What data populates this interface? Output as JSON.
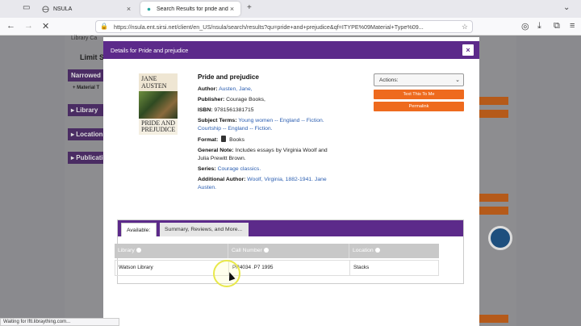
{
  "browser": {
    "tabs": [
      {
        "title": "NSULA",
        "active": false
      },
      {
        "title": "Search Results for pride and prejudice",
        "active": true
      }
    ],
    "url": "https://nsula.ent.sirsi.net/client/en_US/nsula/search/results?qu=pride+and+prejudice&qf=ITYPE%09Material+Type%09..."
  },
  "background": {
    "limit": "Limit S",
    "narrowed": "Narrowed",
    "material": "+ Material T",
    "library": "▸ Library",
    "location": "▸ Location",
    "publication": "▸ Publicatio",
    "library_catalog": "Library Ca"
  },
  "modal": {
    "header": "Details for Pride and prejudice",
    "close": "×",
    "cover": {
      "top_text": "JANE AUSTEN",
      "bottom_text": "PRIDE AND PREJUDICE"
    },
    "title": "Pride and prejudice",
    "author_label": "Author:",
    "author": "Austen, Jane,",
    "publisher_label": "Publisher:",
    "publisher": "Courage Books,",
    "isbn_label": "ISBN:",
    "isbn": "9781561381715",
    "subject_label": "Subject Terms:",
    "subject_1": "Young women -- England -- Fiction.",
    "subject_2": "Courtship -- England -- Fiction.",
    "format_label": "Format:",
    "format": "Books",
    "note_label": "General Note:",
    "note": "Includes essays by Virginia Woolf and Julia Prewitt Brown.",
    "series_label": "Series:",
    "series": "Courage classics.",
    "add_author_label": "Additional Author:",
    "add_author": "Woolf, Virginia, 1882-1941. Jane Austen.",
    "actions_label": "Actions:",
    "text_this": "Text This To Me",
    "permalink": "Permalink",
    "tab_available": "Available:",
    "tab_summary": "Summary, Reviews, and More...",
    "table": {
      "headers": [
        "Library",
        "Call Number",
        "Location"
      ],
      "rows": [
        [
          "Watson Library",
          "PR4034 .P7 1995",
          "Stacks"
        ]
      ]
    }
  },
  "status": "Waiting for lftl.libraything.com..."
}
